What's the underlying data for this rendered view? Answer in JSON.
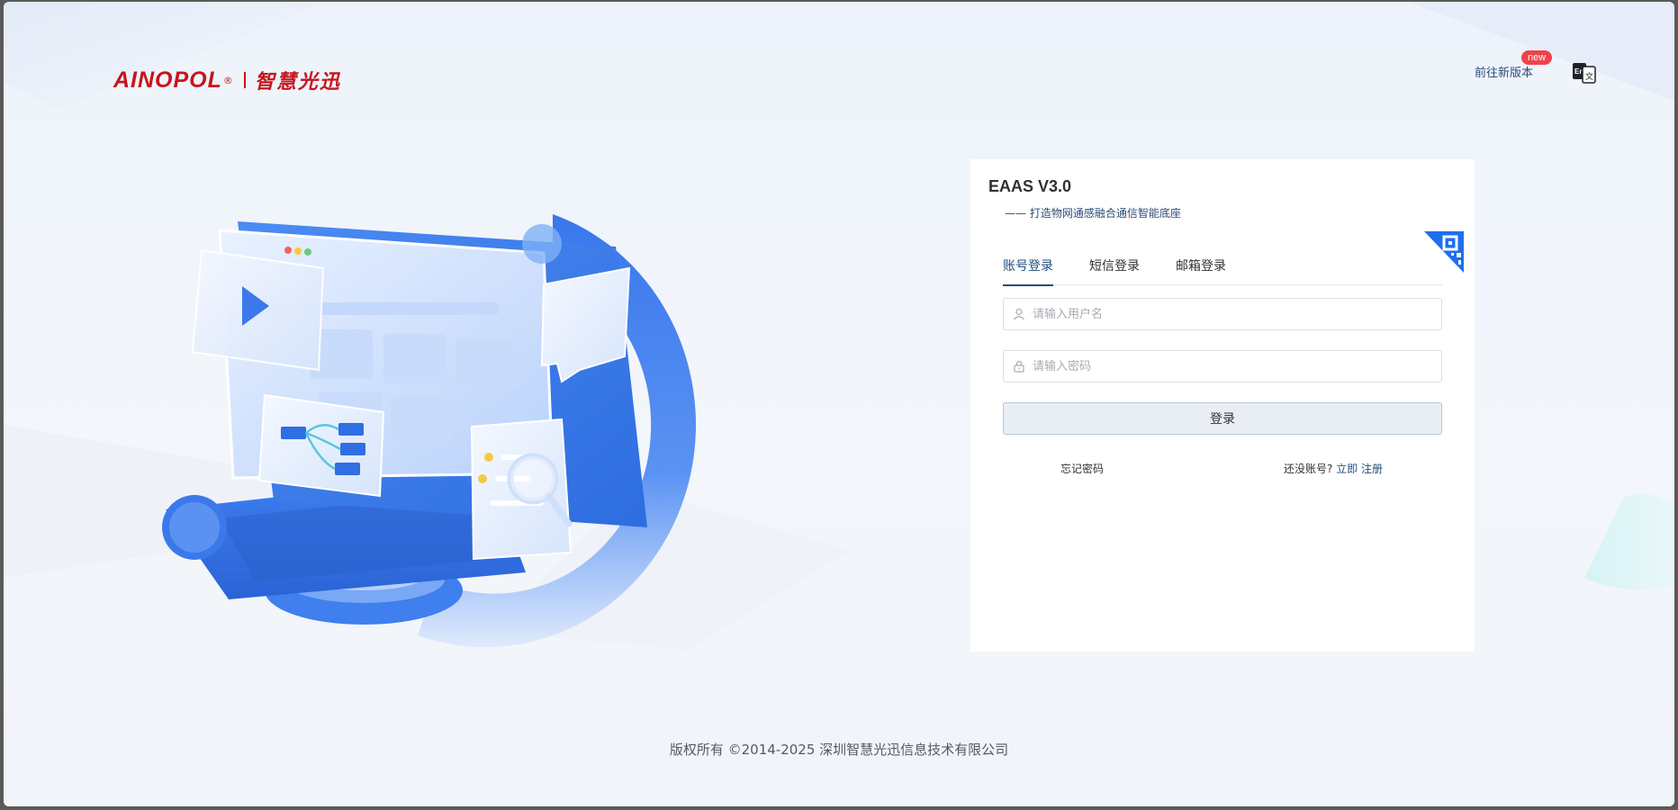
{
  "header": {
    "logo_en": "AINOPOL",
    "logo_reg": "®",
    "logo_cn": "智慧光迅",
    "new_version_link": "前往新版本",
    "new_badge": "new",
    "language_icon": "language-switch-icon"
  },
  "login": {
    "title": "EAAS V3.0",
    "subtitle": "—— 打造物网通感融合通信智能底座",
    "qr_icon": "qr-code-icon",
    "tabs": [
      {
        "label": "账号登录",
        "active": true
      },
      {
        "label": "短信登录",
        "active": false
      },
      {
        "label": "邮箱登录",
        "active": false
      }
    ],
    "username": {
      "placeholder": "请输入用户名",
      "value": "",
      "icon": "user-icon"
    },
    "password": {
      "placeholder": "请输入密码",
      "value": "",
      "icon": "lock-icon"
    },
    "submit_label": "登录",
    "forgot_label": "忘记密码",
    "no_account_label": "还没账号?",
    "register_label": "立即 注册"
  },
  "footer": {
    "copyright": "版权所有 ©2014-2025 深圳智慧光迅信息技术有限公司"
  },
  "colors": {
    "brand_red": "#c8141c",
    "accent": "#1f4e79",
    "badge": "#f0424a",
    "illustration_blue": "#3d7ef0"
  }
}
